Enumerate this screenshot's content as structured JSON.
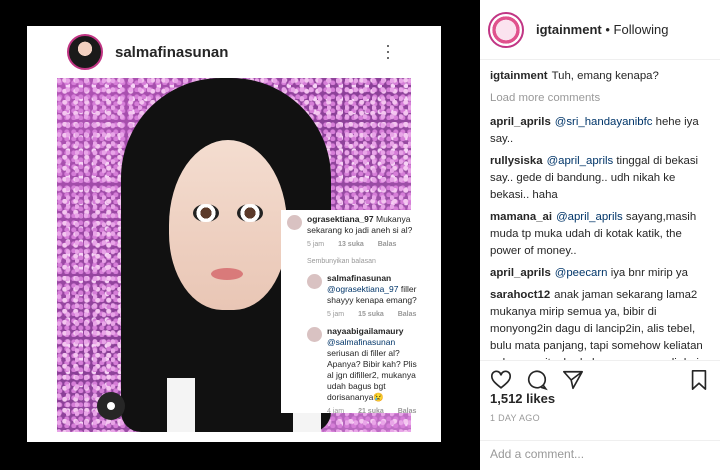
{
  "inner_post": {
    "username": "salmafinasunan",
    "overlay": {
      "comment1": {
        "username": "ograsektiana_97",
        "text": "Mukanya sekarang ko jadi aneh si al?",
        "time": "5 jam",
        "likes": "13 suka",
        "reply": "Balas"
      },
      "hide_replies": "Sembunyikan balasan",
      "reply1": {
        "username": "salmafinasunan",
        "mention": "@ograsektiana_97",
        "text": "filler shayyy kenapa emang?",
        "time": "5 jam",
        "likes": "15 suka",
        "reply": "Balas"
      },
      "reply2": {
        "username": "nayaabigailamaury",
        "mention": "@salmafinasunan",
        "text": "seriusan di filler al? Apanya? Bibir kah? Plis al jgn difiller2, mukanya udah bagus bgt dorisananya😢",
        "time": "4 jam",
        "likes": "21 suka",
        "reply": "Balas"
      }
    }
  },
  "sidebar": {
    "username": "igtainment",
    "follow_status": "• Following",
    "caption": {
      "username": "igtainment",
      "text": "Tuh, emang kenapa?"
    },
    "load_more": "Load more comments",
    "comments": [
      {
        "username": "april_aprils",
        "mention": "@sri_handayanibfc",
        "text": "hehe iya say.."
      },
      {
        "username": "rullysiska",
        "mention": "@april_aprils",
        "text": "tinggal di bekasi say.. gede di bandung.. udh nikah ke bekasi.. haha"
      },
      {
        "username": "mamana_ai",
        "mention": "@april_aprils",
        "text": "sayang,masih muda tp muka udah di kotak katik, the power of money.."
      },
      {
        "username": "april_aprils",
        "mention": "@peecarn",
        "text": "iya bnr mirip ya"
      },
      {
        "username": "sarahoct12",
        "mention": "",
        "text": "anak jaman sekarang lama2 mukanya mirip semua ya, bibir di monyong2in dagu di lancip2in, alis tebel, bulu mata panjang, tapi somehow keliatan palsunya gitu, beda kan sama yg asli dari sananya, buat apa sih kyk gitu? kok mau disamain ama orang lain? jadi orang kok"
      }
    ],
    "likes": "1,512 likes",
    "age": "1 DAY AGO",
    "add_comment_placeholder": "Add a comment..."
  },
  "icons": [
    "more-options-icon",
    "camera-icon",
    "heart-icon",
    "comment-icon",
    "share-icon",
    "bookmark-icon"
  ]
}
